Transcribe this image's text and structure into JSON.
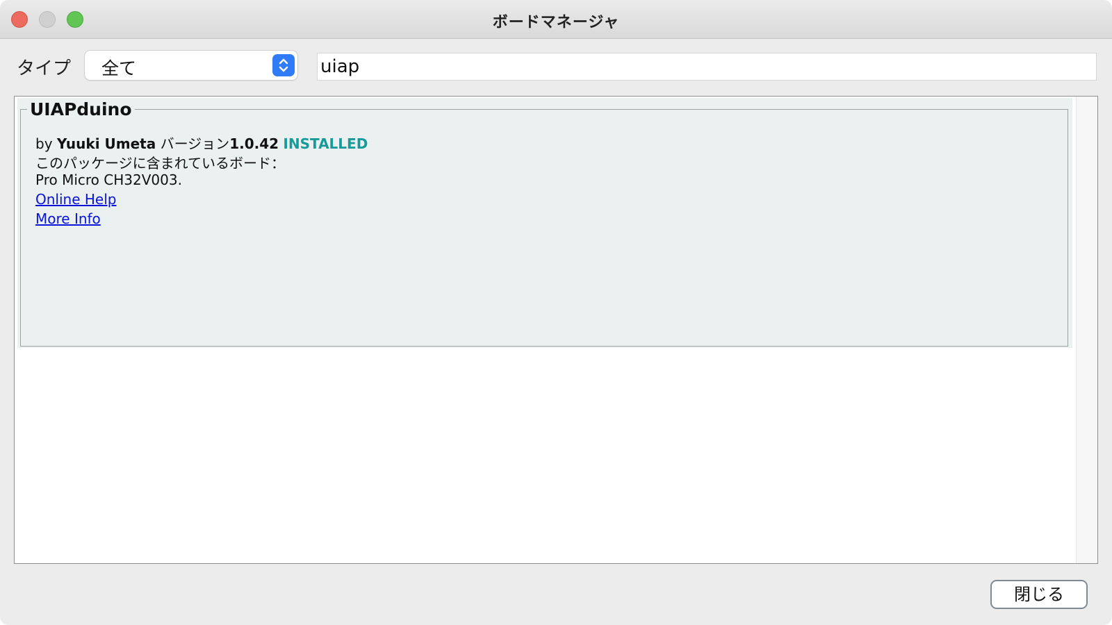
{
  "window": {
    "title": "ボードマネージャ"
  },
  "filter": {
    "type_label": "タイプ",
    "type_value": "全て",
    "search_value": "uiap"
  },
  "entries": [
    {
      "name": "UIAPduino",
      "by_prefix": "by",
      "author": "Yuuki Umeta",
      "version_label": "バージョン",
      "version": "1.0.42",
      "status": "INSTALLED",
      "boards_label": "このパッケージに含まれているボード：",
      "boards": "Pro Micro CH32V003.",
      "online_help": "Online Help",
      "more_info": "More Info"
    }
  ],
  "buttons": {
    "close": "閉じる"
  },
  "colors": {
    "installed": "#18999a",
    "link": "#0b14d9",
    "select_accent": "#2f7cf6",
    "entry_background": "#ebf0f0"
  }
}
